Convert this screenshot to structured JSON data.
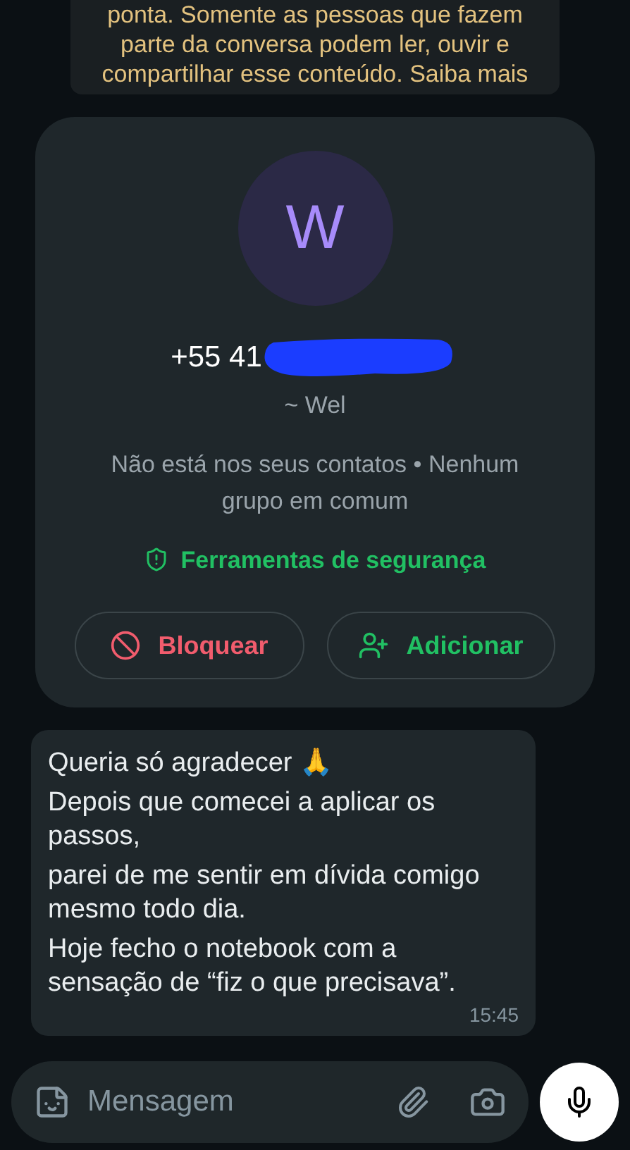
{
  "encryption_notice": {
    "lines": [
      "ponta. Somente as pessoas que fazem",
      "parte da conversa podem ler, ouvir e",
      "compartilhar esse conteúdo. Saiba mais"
    ]
  },
  "contact_card": {
    "avatar_letter": "W",
    "phone": "+55 41",
    "redacted": true,
    "push_name": "~ Wel",
    "info": "Não está nos seus contatos • Nenhum grupo em comum",
    "security_link": "Ferramentas de segurança",
    "buttons": [
      {
        "kind": "block",
        "label": "Bloquear"
      },
      {
        "kind": "add",
        "label": "Adicionar"
      }
    ]
  },
  "message": {
    "lines": [
      "Queria só agradecer 🙏",
      "Depois que comecei a aplicar os passos,",
      "parei de me sentir em dívida comigo mesmo todo dia.",
      "Hoje fecho o notebook com a sensação de “fiz o que precisava”."
    ],
    "time": "15:45"
  },
  "composer": {
    "placeholder": "Mensagem"
  }
}
